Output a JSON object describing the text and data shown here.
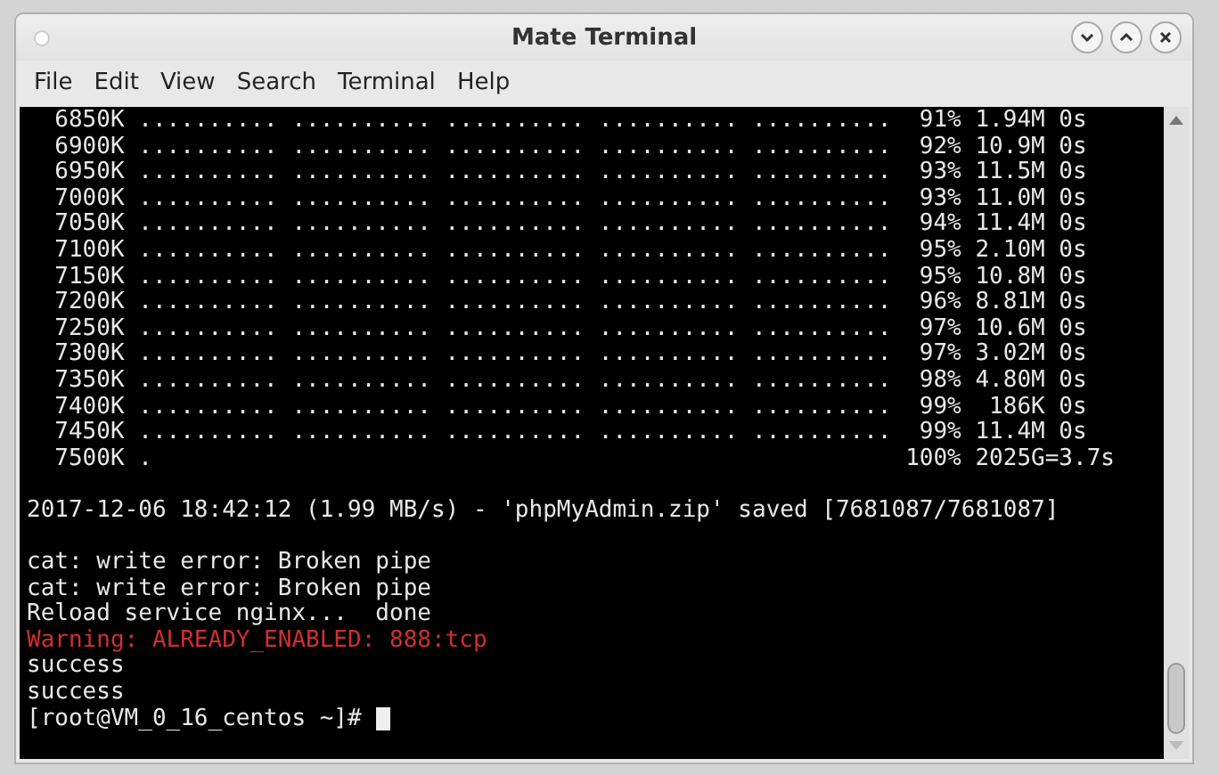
{
  "window": {
    "title": "Mate Terminal"
  },
  "menu": [
    "File",
    "Edit",
    "View",
    "Search",
    "Terminal",
    "Help"
  ],
  "terminal": {
    "lines": [
      {
        "kind": "output",
        "text": "  6850K .......... .......... .......... .......... ..........  91% 1.94M 0s"
      },
      {
        "kind": "output",
        "text": "  6900K .......... .......... .......... .......... ..........  92% 10.9M 0s"
      },
      {
        "kind": "output",
        "text": "  6950K .......... .......... .......... .......... ..........  93% 11.5M 0s"
      },
      {
        "kind": "output",
        "text": "  7000K .......... .......... .......... .......... ..........  93% 11.0M 0s"
      },
      {
        "kind": "output",
        "text": "  7050K .......... .......... .......... .......... ..........  94% 11.4M 0s"
      },
      {
        "kind": "output",
        "text": "  7100K .......... .......... .......... .......... ..........  95% 2.10M 0s"
      },
      {
        "kind": "output",
        "text": "  7150K .......... .......... .......... .......... ..........  95% 10.8M 0s"
      },
      {
        "kind": "output",
        "text": "  7200K .......... .......... .......... .......... ..........  96% 8.81M 0s"
      },
      {
        "kind": "output",
        "text": "  7250K .......... .......... .......... .......... ..........  97% 10.6M 0s"
      },
      {
        "kind": "output",
        "text": "  7300K .......... .......... .......... .......... ..........  97% 3.02M 0s"
      },
      {
        "kind": "output",
        "text": "  7350K .......... .......... .......... .......... ..........  98% 4.80M 0s"
      },
      {
        "kind": "output",
        "text": "  7400K .......... .......... .......... .......... ..........  99%  186K 0s"
      },
      {
        "kind": "output",
        "text": "  7450K .......... .......... .......... .......... ..........  99% 11.4M 0s"
      },
      {
        "kind": "output",
        "text": "  7500K .                                                      100% 2025G=3.7s"
      },
      {
        "kind": "blank"
      },
      {
        "kind": "output",
        "text": "2017-12-06 18:42:12 (1.99 MB/s) - 'phpMyAdmin.zip' saved [7681087/7681087]"
      },
      {
        "kind": "blank"
      },
      {
        "kind": "output",
        "text": "cat: write error: Broken pipe"
      },
      {
        "kind": "output",
        "text": "cat: write error: Broken pipe"
      },
      {
        "kind": "output",
        "text": "Reload service nginx...  done"
      },
      {
        "kind": "warning",
        "text": "Warning: ALREADY_ENABLED: 888:tcp"
      },
      {
        "kind": "output",
        "text": "success"
      },
      {
        "kind": "output",
        "text": "success"
      }
    ],
    "prompt": "[root@VM_0_16_centos ~]#"
  }
}
